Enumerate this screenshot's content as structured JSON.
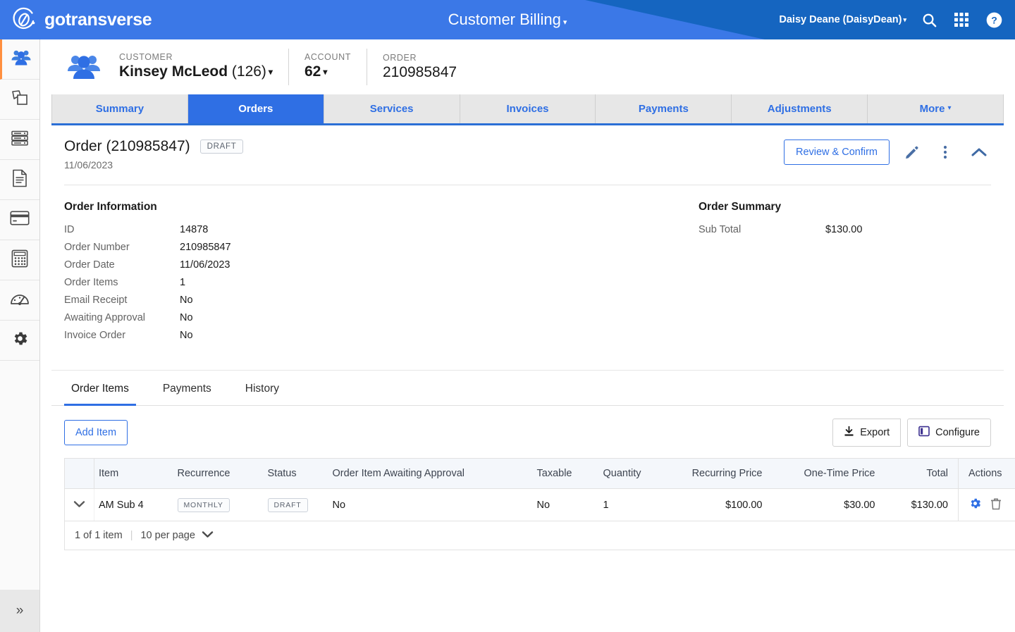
{
  "header": {
    "logo_text": "gotransverse",
    "logo_icon": "gotransverse-circle-logo",
    "app_title": "Customer Billing",
    "app_title_caret": "▾",
    "user": "Daisy Deane (DaisyDean)",
    "user_caret": "▾",
    "icons": [
      "search-icon",
      "apps-grid-icon",
      "help-circle-icon"
    ]
  },
  "rail": {
    "items": [
      {
        "name": "customers-icon",
        "active": true
      },
      {
        "name": "products-copy-icon",
        "active": false
      },
      {
        "name": "rates-server-icon",
        "active": false
      },
      {
        "name": "invoices-document-icon",
        "active": false
      },
      {
        "name": "payments-card-icon",
        "active": false
      },
      {
        "name": "calculator-icon",
        "active": false
      },
      {
        "name": "dashboard-gauge-icon",
        "active": false
      },
      {
        "name": "settings-gear-icon",
        "active": false
      }
    ],
    "expand_glyph": "»"
  },
  "breadcrumb": {
    "customer_label": "CUSTOMER",
    "customer_name": "Kinsey McLeod",
    "customer_id": "(126)",
    "account_label": "ACCOUNT",
    "account_value": "62",
    "order_label": "ORDER",
    "order_value": "210985847",
    "caret": "▾"
  },
  "tabs": [
    {
      "label": "Summary",
      "active": false
    },
    {
      "label": "Orders",
      "active": true
    },
    {
      "label": "Services",
      "active": false
    },
    {
      "label": "Invoices",
      "active": false
    },
    {
      "label": "Payments",
      "active": false
    },
    {
      "label": "Adjustments",
      "active": false
    },
    {
      "label": "More",
      "active": false,
      "caret": "▾"
    }
  ],
  "order_card": {
    "title": "Order (210985847)",
    "status_badge": "DRAFT",
    "date": "11/06/2023",
    "review_confirm_label": "Review & Confirm",
    "action_icons": [
      "pencil-edit-icon",
      "vertical-dots-icon",
      "chevron-up-collapse-icon"
    ]
  },
  "order_information": {
    "heading": "Order Information",
    "rows": [
      {
        "key": "ID",
        "value": "14878"
      },
      {
        "key": "Order Number",
        "value": "210985847"
      },
      {
        "key": "Order Date",
        "value": "11/06/2023"
      },
      {
        "key": "Order Items",
        "value": "1"
      },
      {
        "key": "Email Receipt",
        "value": "No"
      },
      {
        "key": "Awaiting Approval",
        "value": "No"
      },
      {
        "key": "Invoice Order",
        "value": "No"
      }
    ]
  },
  "order_summary": {
    "heading": "Order Summary",
    "rows": [
      {
        "key": "Sub Total",
        "value": "$130.00"
      }
    ]
  },
  "subtabs": [
    {
      "label": "Order Items",
      "active": true
    },
    {
      "label": "Payments",
      "active": false
    },
    {
      "label": "History",
      "active": false
    }
  ],
  "table_toolbar": {
    "add_item_label": "Add Item",
    "export_label": "Export",
    "configure_label": "Configure"
  },
  "table": {
    "columns": [
      "Item",
      "Recurrence",
      "Status",
      "Order Item Awaiting Approval",
      "Taxable",
      "Quantity",
      "Recurring Price",
      "One-Time Price",
      "Total",
      "Actions"
    ],
    "rows": [
      {
        "item": "AM Sub 4",
        "recurrence": "MONTHLY",
        "status": "DRAFT",
        "awaiting_approval": "No",
        "taxable": "No",
        "quantity": "1",
        "recurring_price": "$100.00",
        "one_time_price": "$30.00",
        "total": "$130.00",
        "actions": [
          "settings-gear-icon",
          "trash-delete-icon"
        ]
      }
    ],
    "pager": {
      "count_text": "1 of 1 item",
      "per_page_text": "10 per page",
      "caret": "⌄"
    }
  },
  "colors": {
    "header_blue": "#1565c0",
    "header_blue_light": "#3b78e7",
    "accent_blue": "#2f6fe4",
    "tab_inactive_bg": "#e7e7e7",
    "table_header_bg": "#f4f7fb",
    "rail_active_marker": "#ff8f3f"
  }
}
